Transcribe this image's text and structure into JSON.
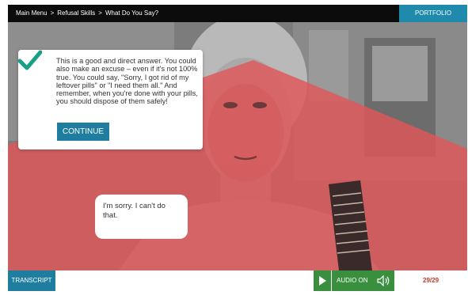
{
  "breadcrumb": {
    "items": [
      "Main Menu",
      "Refusal Skills",
      "What Do You Say?"
    ],
    "separator": ">"
  },
  "header": {
    "portfolio_label": "PORTFOLIO"
  },
  "feedback": {
    "text": "This is a good and direct answer. You could also make an excuse – even if it's not 100% true. You could say, \"Sorry, I got rid of my leftover pills\" or \"I need them all.\" And remember, when you're done with your pills, you should dispose of them safely!",
    "continue_label": "CONTINUE",
    "icon": "checkmark-icon"
  },
  "speech": {
    "text": "I'm sorry. I can't do that."
  },
  "footer": {
    "transcript_label": "TRANSCRIPT",
    "audio_label": "AUDIO ON",
    "page_counter": "29/29"
  },
  "colors": {
    "accent": "#1f7ea0",
    "portfolio": "#1f8aab",
    "audio_green": "#3a8f3f",
    "overlay_red": "#e0575a",
    "check_green": "#16a085",
    "counter": "#c0392b"
  }
}
